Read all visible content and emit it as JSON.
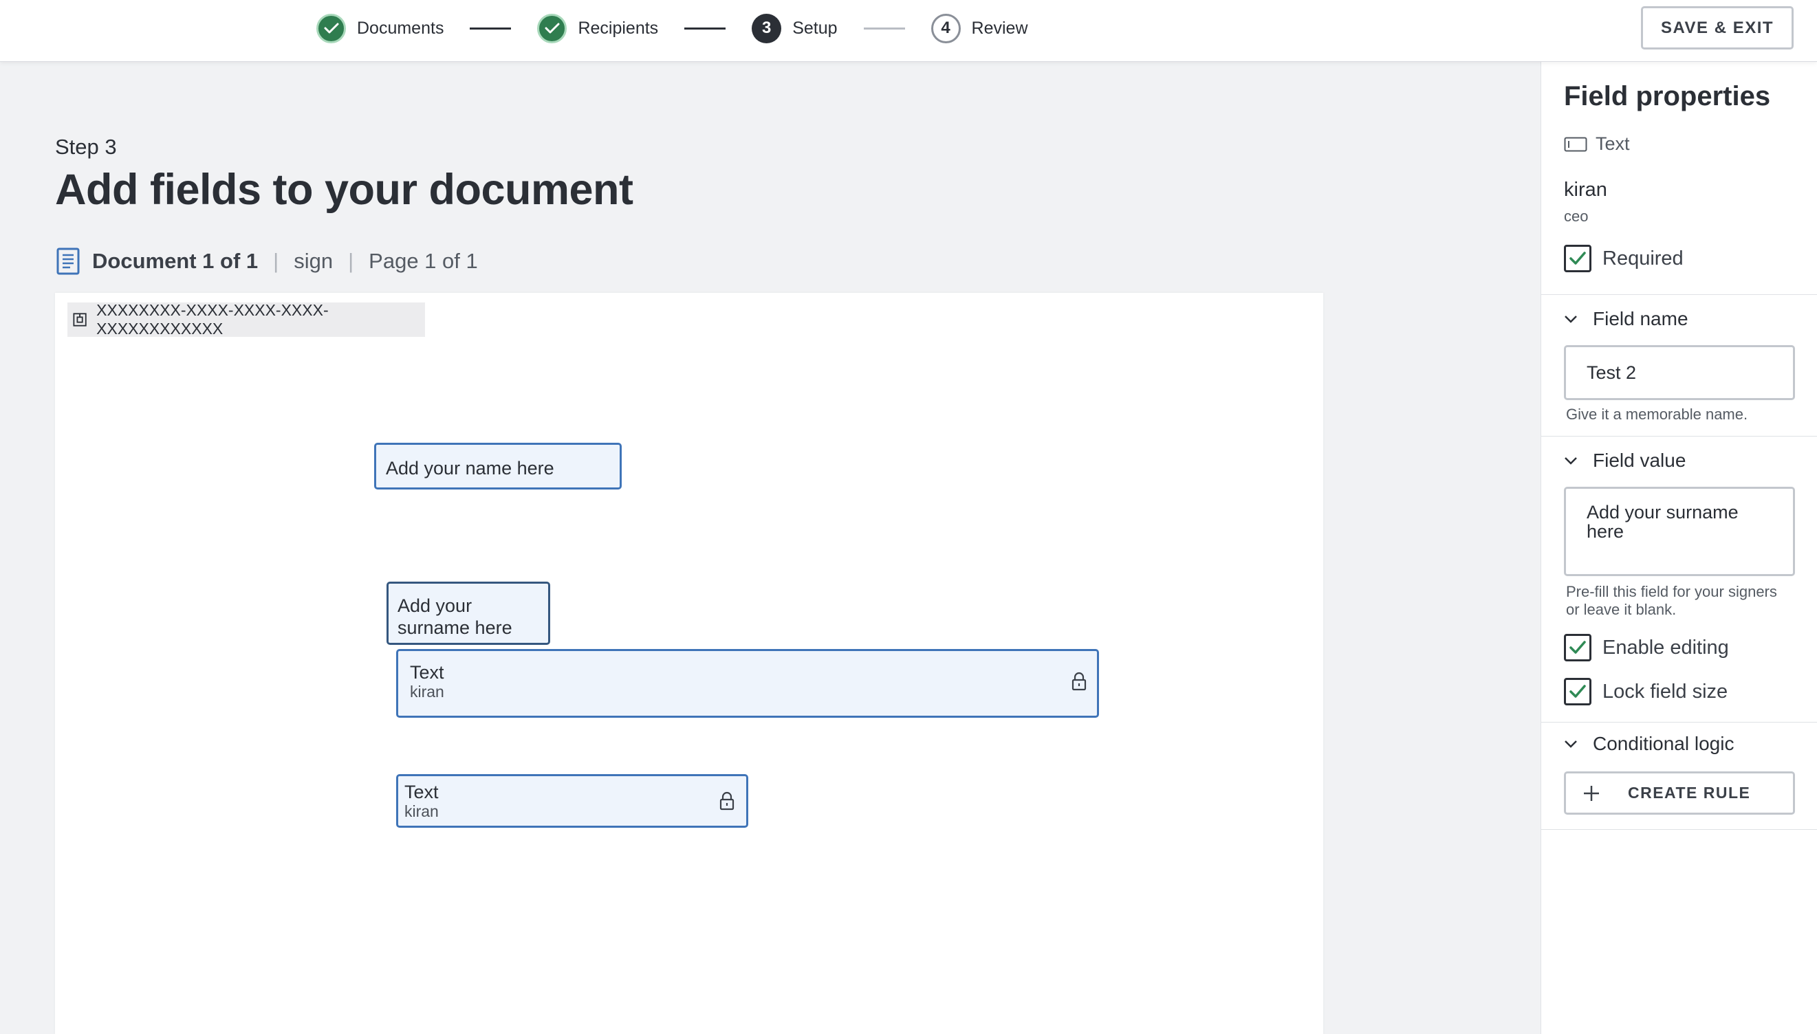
{
  "stepper": {
    "steps": [
      {
        "label": "Documents",
        "state": "done",
        "number": ""
      },
      {
        "label": "Recipients",
        "state": "done",
        "number": ""
      },
      {
        "label": "Setup",
        "state": "current",
        "number": "3"
      },
      {
        "label": "Review",
        "state": "upcoming",
        "number": "4"
      }
    ]
  },
  "header": {
    "save_exit_label": "SAVE & EXIT"
  },
  "main": {
    "step_eyebrow": "Step 3",
    "title": "Add fields to your document",
    "doc_count": "Document 1 of 1",
    "doc_name": "sign",
    "page_info": "Page 1 of 1",
    "envelope_id": "XXXXXXXX-XXXX-XXXX-XXXX-XXXXXXXXXXXX"
  },
  "fields": {
    "name_field": "Add your name here",
    "surname_field_line1": "Add your",
    "surname_field_line2": "surname here",
    "text_field_1": {
      "type": "Text",
      "recipient": "kiran"
    },
    "text_field_2": {
      "type": "Text",
      "recipient": "kiran"
    }
  },
  "sidebar": {
    "title": "Field properties",
    "field_type": "Text",
    "recipient_name": "kiran",
    "recipient_role": "ceo",
    "required_label": "Required",
    "required_checked": true,
    "field_name_section": "Field name",
    "field_name_value": "Test 2",
    "field_name_help": "Give it a memorable name.",
    "field_value_section": "Field value",
    "field_value_value": "Add your surname here",
    "field_value_help_line1": "Pre-fill this field for your signers",
    "field_value_help_line2": "or leave it blank.",
    "enable_editing_label": "Enable editing",
    "enable_editing_checked": true,
    "lock_size_label": "Lock field size",
    "lock_size_checked": true,
    "conditional_section": "Conditional logic",
    "create_rule_label": "CREATE RULE"
  },
  "colors": {
    "done_green": "#2f7d4f",
    "field_border_blue": "#3f74b8",
    "field_fill": "#eef4fc",
    "checkbox_green": "#2f8a55",
    "dark_text": "#2b2f36"
  },
  "icons": [
    "check-icon",
    "document-icon",
    "envelope-id-icon",
    "lock-icon",
    "text-field-icon",
    "chevron-down-icon",
    "plus-icon"
  ]
}
